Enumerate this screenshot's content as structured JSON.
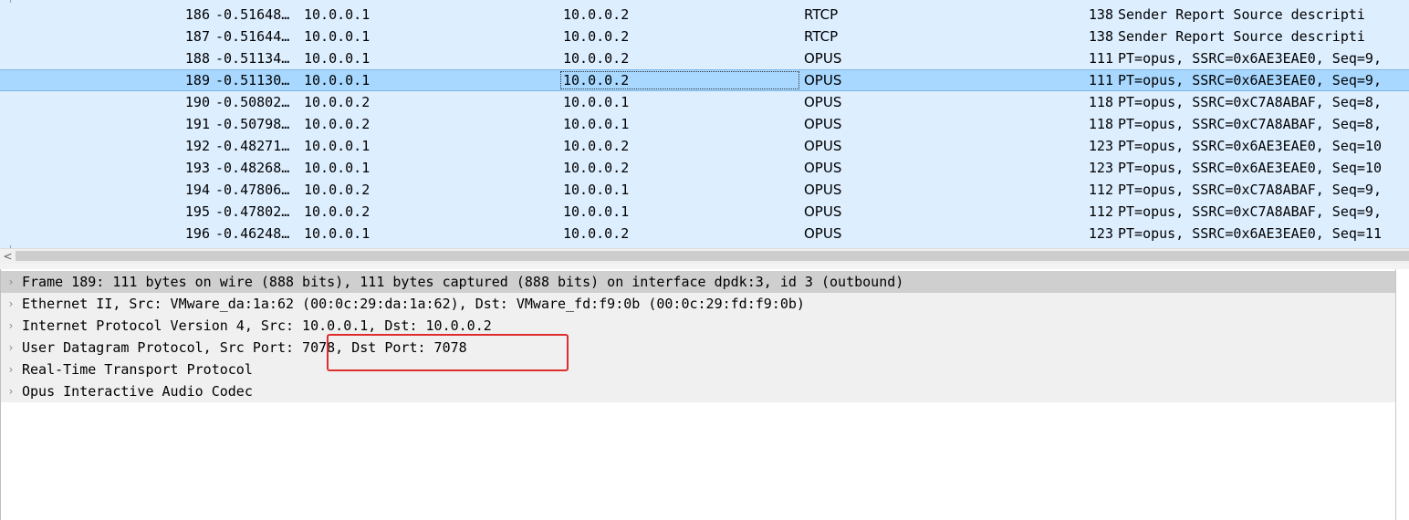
{
  "packet_list": {
    "rows": [
      {
        "no": "186",
        "time": "-0.51648…",
        "source": "10.0.0.1",
        "destination": "10.0.0.2",
        "protocol": "RTCP",
        "length": "138",
        "info": "Sender Report   Source descripti"
      },
      {
        "no": "187",
        "time": "-0.51644…",
        "source": "10.0.0.1",
        "destination": "10.0.0.2",
        "protocol": "RTCP",
        "length": "138",
        "info": "Sender Report   Source descripti"
      },
      {
        "no": "188",
        "time": "-0.51134…",
        "source": "10.0.0.1",
        "destination": "10.0.0.2",
        "protocol": "OPUS",
        "length": "111",
        "info": "PT=opus, SSRC=0x6AE3EAE0, Seq=9,"
      },
      {
        "no": "189",
        "time": "-0.51130…",
        "source": "10.0.0.1",
        "destination": "10.0.0.2",
        "protocol": "OPUS",
        "length": "111",
        "info": "PT=opus, SSRC=0x6AE3EAE0, Seq=9,"
      },
      {
        "no": "190",
        "time": "-0.50802…",
        "source": "10.0.0.2",
        "destination": "10.0.0.1",
        "protocol": "OPUS",
        "length": "118",
        "info": "PT=opus, SSRC=0xC7A8ABAF, Seq=8,"
      },
      {
        "no": "191",
        "time": "-0.50798…",
        "source": "10.0.0.2",
        "destination": "10.0.0.1",
        "protocol": "OPUS",
        "length": "118",
        "info": "PT=opus, SSRC=0xC7A8ABAF, Seq=8,"
      },
      {
        "no": "192",
        "time": "-0.48271…",
        "source": "10.0.0.1",
        "destination": "10.0.0.2",
        "protocol": "OPUS",
        "length": "123",
        "info": "PT=opus, SSRC=0x6AE3EAE0, Seq=10"
      },
      {
        "no": "193",
        "time": "-0.48268…",
        "source": "10.0.0.1",
        "destination": "10.0.0.2",
        "protocol": "OPUS",
        "length": "123",
        "info": "PT=opus, SSRC=0x6AE3EAE0, Seq=10"
      },
      {
        "no": "194",
        "time": "-0.47806…",
        "source": "10.0.0.2",
        "destination": "10.0.0.1",
        "protocol": "OPUS",
        "length": "112",
        "info": "PT=opus, SSRC=0xC7A8ABAF, Seq=9,"
      },
      {
        "no": "195",
        "time": "-0.47802…",
        "source": "10.0.0.2",
        "destination": "10.0.0.1",
        "protocol": "OPUS",
        "length": "112",
        "info": "PT=opus, SSRC=0xC7A8ABAF, Seq=9,"
      },
      {
        "no": "196",
        "time": "-0.46248…",
        "source": "10.0.0.1",
        "destination": "10.0.0.2",
        "protocol": "OPUS",
        "length": "123",
        "info": "PT=opus, SSRC=0x6AE3EAE0, Seq=11"
      }
    ],
    "selected_no": "189"
  },
  "scrollbar": {
    "left_arrow": "<"
  },
  "details": {
    "expander": "›",
    "items": [
      "Frame 189: 111 bytes on wire (888 bits), 111 bytes captured (888 bits) on interface dpdk:3, id 3 (outbound)",
      "Ethernet II, Src: VMware_da:1a:62 (00:0c:29:da:1a:62), Dst: VMware_fd:f9:0b (00:0c:29:fd:f9:0b)",
      "Internet Protocol Version 4, Src: 10.0.0.1, Dst: 10.0.0.2",
      "User Datagram Protocol, Src Port: 7078, Dst Port: 7078",
      "Real-Time Transport Protocol",
      "Opus Interactive Audio Codec"
    ]
  },
  "colors": {
    "list_background": "#ddeeff",
    "selected_row": "#a8d8ff",
    "details_background": "#f0f0f0",
    "highlight_box": "#dd2e2e"
  }
}
